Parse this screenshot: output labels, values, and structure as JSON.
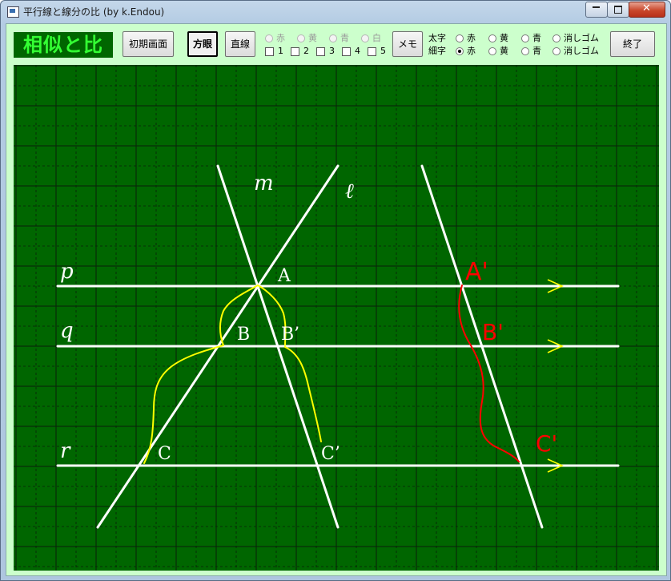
{
  "window": {
    "title": "平行線と線分の比 (by k.Endou)"
  },
  "logo": "相似と比",
  "toolbar": {
    "initial_label": "初期画面",
    "grid_label": "方眼",
    "line_label": "直線",
    "memo_label": "メモ",
    "end_label": "終了"
  },
  "line_colors": [
    "赤",
    "黄",
    "青",
    "白"
  ],
  "line_numbers": [
    "1",
    "2",
    "3",
    "4",
    "5"
  ],
  "pen": {
    "thick_label": "太字",
    "thin_label": "細字",
    "options": [
      "赤",
      "黄",
      "青",
      "消しゴム"
    ],
    "selected": "細字-赤"
  },
  "board": {
    "line_labels": {
      "p": "p",
      "q": "q",
      "r": "r",
      "m": "m",
      "l": "ℓ"
    },
    "points": {
      "A": "A",
      "B": "B",
      "B2": "B’",
      "C": "C",
      "C2": "C’"
    },
    "handwriting": [
      "A'",
      "B'",
      "C'"
    ],
    "colors": {
      "board": "#006600",
      "grid": "#0a1f0a",
      "lines": "#ffffff",
      "arrows": "#ffff00",
      "yellow_pen": "#ffff00",
      "red_pen": "#ff0000"
    }
  }
}
